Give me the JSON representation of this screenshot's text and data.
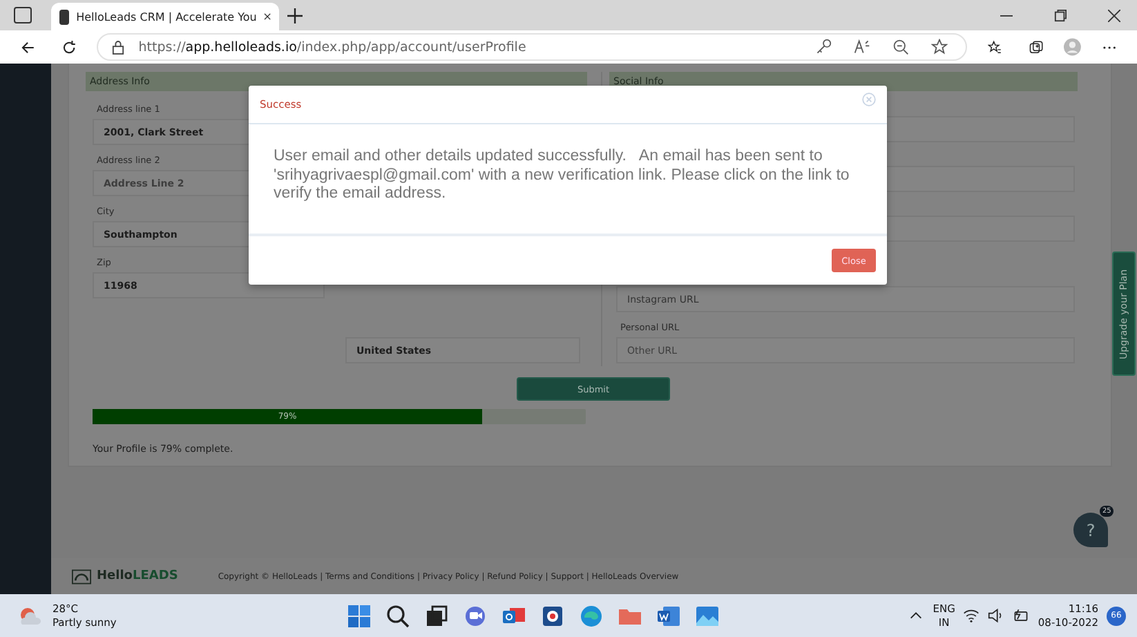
{
  "browser": {
    "tab_title": "HelloLeads CRM | Accelerate You",
    "url_host": "app.helloleads.io",
    "url_prefix": "https://",
    "url_path": "/index.php/app/account/userProfile"
  },
  "address_info": {
    "title": "Address Info",
    "fields": [
      {
        "label": "Address line 1",
        "value": "2001, Clark Street"
      },
      {
        "label": "Address line 2",
        "placeholder": "Address Line 2"
      },
      {
        "label": "City",
        "value": "Southampton"
      },
      {
        "label": "Zip",
        "value": "11968"
      }
    ]
  },
  "country_field": {
    "value": "United States"
  },
  "social_info": {
    "title": "Social Info",
    "fields": [
      {
        "value": "Instagram URL"
      },
      {
        "label": "Personal URL",
        "placeholder": "Other URL"
      }
    ]
  },
  "submit_button": "Submit",
  "profile_progress": {
    "level": 0.79,
    "label": "79%",
    "caption": "Your Profile is 79% complete."
  },
  "upgrade_tab": "Upgrade your Plan",
  "help": {
    "label": "?",
    "badge": "25"
  },
  "footer": {
    "logo_hello": "Hello",
    "logo_leads": "LEADS",
    "text": "Copyright © HelloLeads | Terms and Conditions | Privacy Policy | Refund Policy | Support | HelloLeads Overview"
  },
  "modal": {
    "title": "Success",
    "message": "User email and other details updated successfully.   An email has been sent to 'srihyagrivaespl@gmail.com' with a new verification link. Please click on the link to verify the email address.",
    "close_button": "Close"
  },
  "taskbar": {
    "temperature": "28°C",
    "weather": "Partly sunny",
    "language": "ENG",
    "region": "IN",
    "time": "11:16",
    "date": "08-10-2022",
    "notifications": "66"
  }
}
